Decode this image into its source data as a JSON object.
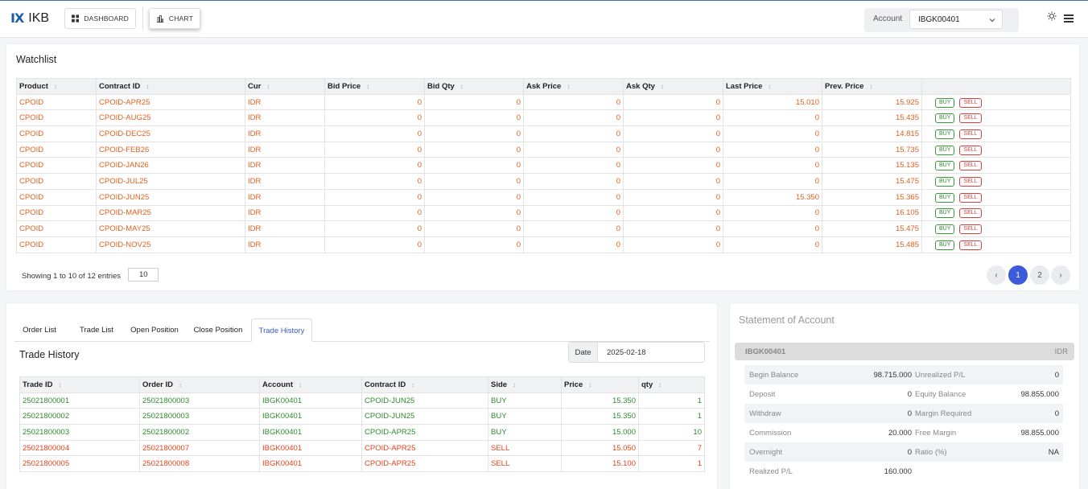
{
  "header": {
    "logo_mark": "IX",
    "logo_text": "IKB",
    "nav": [
      {
        "label": "DASHBOARD"
      },
      {
        "label": "CHART"
      }
    ],
    "account_label": "Account",
    "account_value": "IBGK00401"
  },
  "watchlist": {
    "title": "Watchlist",
    "columns": [
      "Product",
      "Contract ID",
      "Cur",
      "Bid Price",
      "Bid Qty",
      "Ask Price",
      "Ask Qty",
      "Last Price",
      "Prev. Price"
    ],
    "buy_label": "BUY",
    "sell_label": "SELL",
    "rows": [
      [
        "CPOID",
        "CPOID-APR25",
        "IDR",
        "0",
        "0",
        "0",
        "0",
        "15.010",
        "15.925"
      ],
      [
        "CPOID",
        "CPOID-AUG25",
        "IDR",
        "0",
        "0",
        "0",
        "0",
        "0",
        "15.435"
      ],
      [
        "CPOID",
        "CPOID-DEC25",
        "IDR",
        "0",
        "0",
        "0",
        "0",
        "0",
        "14.815"
      ],
      [
        "CPOID",
        "CPOID-FEB26",
        "IDR",
        "0",
        "0",
        "0",
        "0",
        "0",
        "15.735"
      ],
      [
        "CPOID",
        "CPOID-JAN26",
        "IDR",
        "0",
        "0",
        "0",
        "0",
        "0",
        "15.135"
      ],
      [
        "CPOID",
        "CPOID-JUL25",
        "IDR",
        "0",
        "0",
        "0",
        "0",
        "0",
        "15.475"
      ],
      [
        "CPOID",
        "CPOID-JUN25",
        "IDR",
        "0",
        "0",
        "0",
        "0",
        "15.350",
        "15.365"
      ],
      [
        "CPOID",
        "CPOID-MAR25",
        "IDR",
        "0",
        "0",
        "0",
        "0",
        "0",
        "16.105"
      ],
      [
        "CPOID",
        "CPOID-MAY25",
        "IDR",
        "0",
        "0",
        "0",
        "0",
        "0",
        "15.475"
      ],
      [
        "CPOID",
        "CPOID-NOV25",
        "IDR",
        "0",
        "0",
        "0",
        "0",
        "0",
        "15.485"
      ]
    ],
    "showing_text": "Showing 1 to 10 of 12 entries",
    "page_size": "10",
    "pages": [
      "1",
      "2"
    ],
    "prev_glyph": "‹",
    "next_glyph": "›"
  },
  "orders": {
    "tabs": [
      "Order List",
      "Trade List",
      "Open Position",
      "Close Position",
      "Trade History"
    ],
    "active_tab": "Trade History",
    "title": "Trade History",
    "date_label": "Date",
    "date_value": "2025-02-18",
    "columns": [
      "Trade ID",
      "Order ID",
      "Account",
      "Contract ID",
      "Side",
      "Price",
      "qty"
    ],
    "rows": [
      [
        "25021800001",
        "25021800003",
        "IBGK00401",
        "CPOID-JUN25",
        "BUY",
        "15.350",
        "1"
      ],
      [
        "25021800002",
        "25021800003",
        "IBGK00401",
        "CPOID-JUN25",
        "BUY",
        "15.350",
        "1"
      ],
      [
        "25021800003",
        "25021800002",
        "IBGK00401",
        "CPOID-APR25",
        "BUY",
        "15.000",
        "10"
      ],
      [
        "25021800004",
        "25021800007",
        "IBGK00401",
        "CPOID-APR25",
        "SELL",
        "15.050",
        "7"
      ],
      [
        "25021800005",
        "25021800008",
        "IBGK00401",
        "CPOID-APR25",
        "SELL",
        "15.100",
        "1"
      ]
    ]
  },
  "statement": {
    "title": "Statement of Account",
    "account": "IBGK00401",
    "currency": "IDR",
    "rows": [
      {
        "l1": "Begin Balance",
        "v1": "98.715.000",
        "l2": "Unrealized P/L",
        "v2": "0"
      },
      {
        "l1": "Deposit",
        "v1": "0",
        "l2": "Equity Balance",
        "v2": "98.855.000"
      },
      {
        "l1": "Withdraw",
        "v1": "0",
        "l2": "Margin Required",
        "v2": "0"
      },
      {
        "l1": "Commission",
        "v1": "20.000",
        "l2": "Free Margin",
        "v2": "98.855.000"
      },
      {
        "l1": "Overnight",
        "v1": "0",
        "l2": "Ratio (%)",
        "v2": "NA"
      },
      {
        "l1": "Realized P/L",
        "v1": "160.000",
        "l2": "",
        "v2": ""
      }
    ]
  },
  "colors": {
    "accent": "#3b5bdb",
    "orange": "#e25f1c",
    "green": "#2e8b2e",
    "red": "#e8421e"
  }
}
